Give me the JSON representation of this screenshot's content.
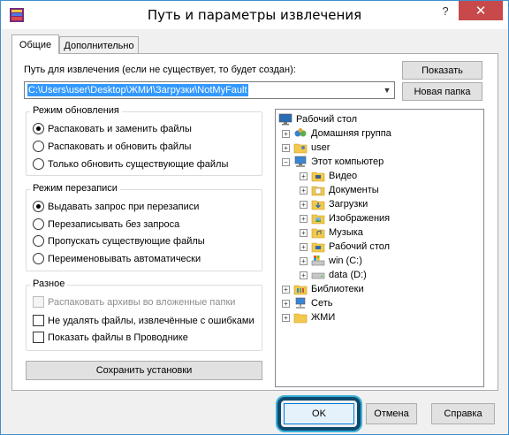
{
  "window": {
    "title": "Путь и параметры извлечения",
    "help_label": "?",
    "close_label": "✕"
  },
  "tabs": [
    {
      "label": "Общие",
      "active": true
    },
    {
      "label": "Дополнительно",
      "active": false
    }
  ],
  "path": {
    "label": "Путь для извлечения (если не существует, то будет создан):",
    "value": "C:\\Users\\user\\Desktop\\ЖМИ\\Загрузки\\NotMyFault"
  },
  "buttons": {
    "show": "Показать",
    "new_folder": "Новая папка",
    "save_settings": "Сохранить установки",
    "ok": "OK",
    "cancel": "Отмена",
    "help": "Справка"
  },
  "update_mode": {
    "title": "Режим обновления",
    "options": [
      {
        "label": "Распаковать и заменить файлы",
        "selected": true
      },
      {
        "label": "Распаковать и обновить файлы",
        "selected": false
      },
      {
        "label": "Только обновить существующие файлы",
        "selected": false
      }
    ]
  },
  "overwrite_mode": {
    "title": "Режим перезаписи",
    "options": [
      {
        "label": "Выдавать запрос при перезаписи",
        "selected": true
      },
      {
        "label": "Перезаписывать без запроса",
        "selected": false
      },
      {
        "label": "Пропускать существующие файлы",
        "selected": false
      },
      {
        "label": "Переименовывать автоматически",
        "selected": false
      }
    ]
  },
  "misc": {
    "title": "Разное",
    "options": [
      {
        "label": "Распаковать архивы во вложенные папки",
        "checked": false,
        "disabled": true
      },
      {
        "label": "Не удалять файлы, извлечённые с ошибками",
        "checked": false,
        "disabled": false
      },
      {
        "label": "Показать файлы в Проводнике",
        "checked": false,
        "disabled": false
      }
    ]
  },
  "tree": [
    {
      "label": "Рабочий стол",
      "icon": "desktop-icon"
    },
    {
      "label": "Домашняя группа",
      "icon": "homegroup-icon"
    },
    {
      "label": "user",
      "icon": "user-folder-icon"
    },
    {
      "label": "Этот компьютер",
      "icon": "computer-icon"
    },
    {
      "label": "Видео",
      "icon": "video-folder-icon"
    },
    {
      "label": "Документы",
      "icon": "documents-folder-icon"
    },
    {
      "label": "Загрузки",
      "icon": "downloads-folder-icon"
    },
    {
      "label": "Изображения",
      "icon": "pictures-folder-icon"
    },
    {
      "label": "Музыка",
      "icon": "music-folder-icon"
    },
    {
      "label": "Рабочий стол",
      "icon": "desktop-folder-icon"
    },
    {
      "label": "win (C:)",
      "icon": "system-drive-icon"
    },
    {
      "label": "data (D:)",
      "icon": "drive-icon"
    },
    {
      "label": "Библиотеки",
      "icon": "libraries-icon"
    },
    {
      "label": "Сеть",
      "icon": "network-icon"
    },
    {
      "label": "ЖМИ",
      "icon": "folder-icon"
    }
  ],
  "colors": {
    "selection": "#3399ff",
    "highlight_ring": "#3ab0d9",
    "close_button": "#c7494a"
  }
}
